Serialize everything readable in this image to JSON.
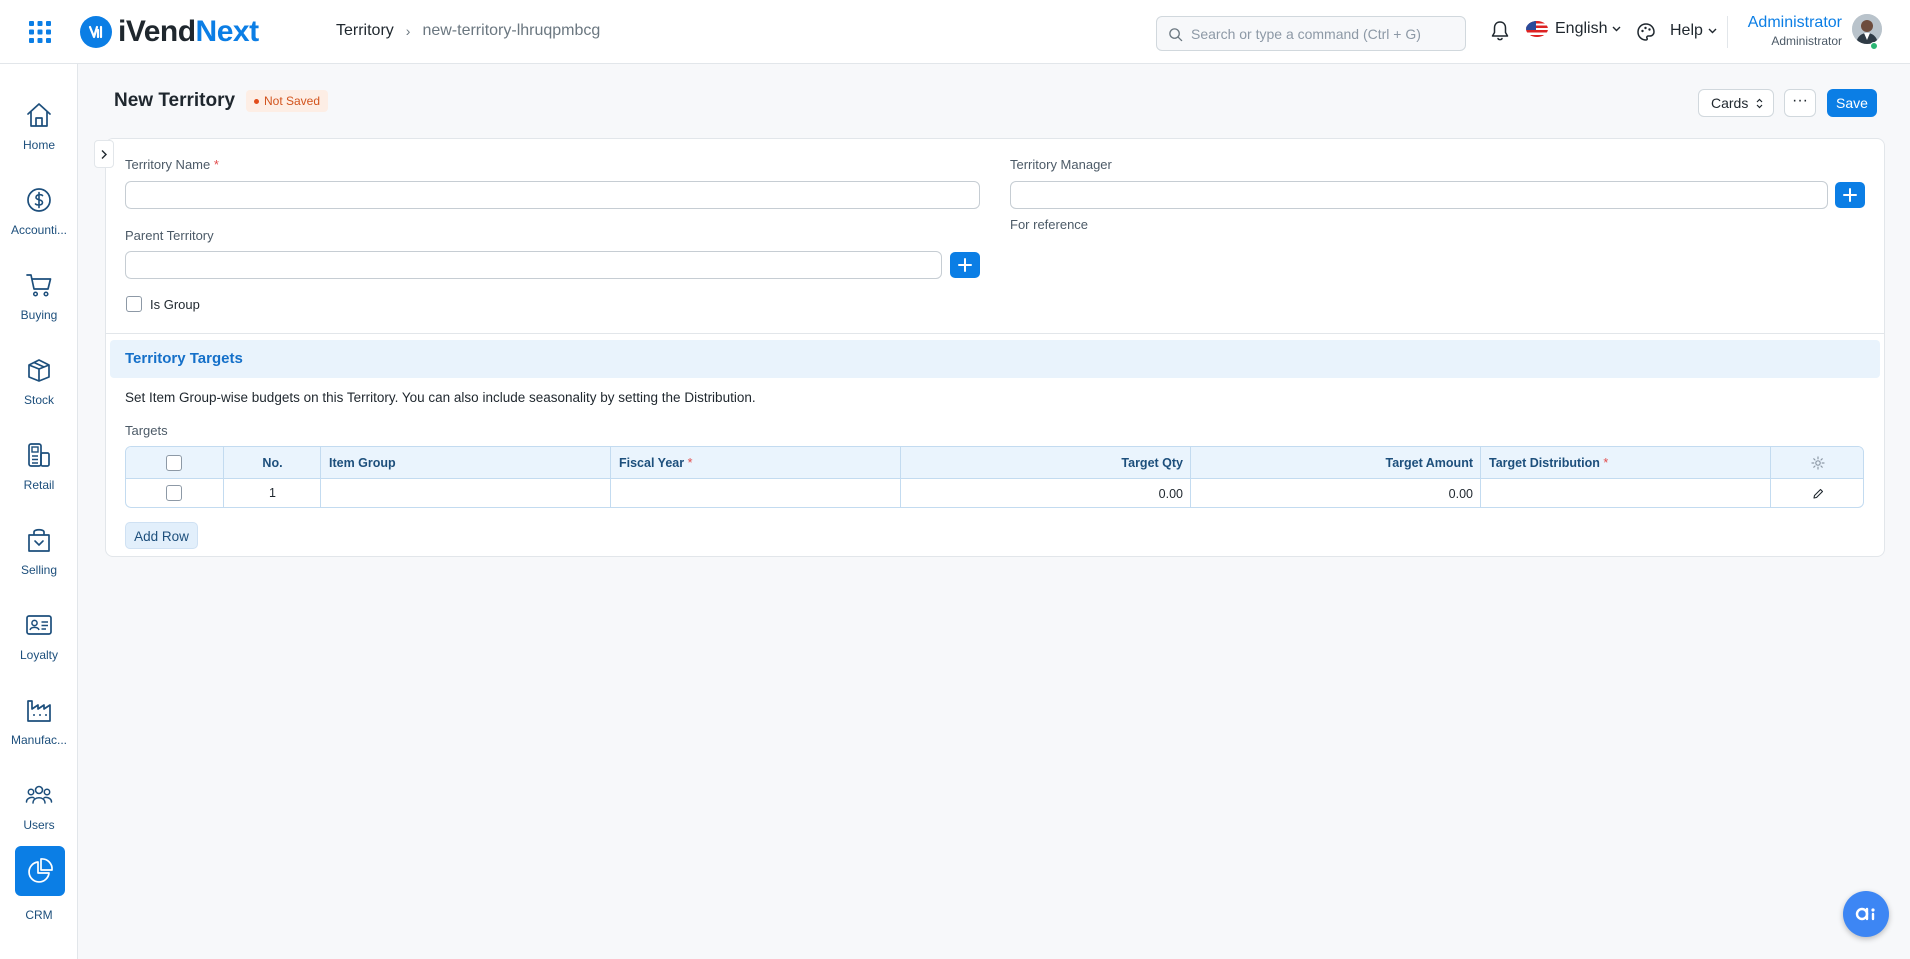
{
  "app": {
    "brand_part1": "iVend",
    "brand_part2": "Next"
  },
  "breadcrumb": {
    "root": "Territory",
    "separator": "›",
    "current": "new-territory-lhruqpmbcg"
  },
  "search": {
    "placeholder": "Search or type a command (Ctrl + G)"
  },
  "header": {
    "language": "English",
    "help": "Help",
    "user_name": "Administrator",
    "user_role": "Administrator"
  },
  "sidebar": {
    "items": [
      {
        "label": "Home",
        "icon": "home-icon"
      },
      {
        "label": "Accounti...",
        "icon": "dollar-circle-icon"
      },
      {
        "label": "Buying",
        "icon": "cart-icon"
      },
      {
        "label": "Stock",
        "icon": "box-icon"
      },
      {
        "label": "Retail",
        "icon": "pos-terminal-icon"
      },
      {
        "label": "Selling",
        "icon": "shopping-bag-icon"
      },
      {
        "label": "Loyalty",
        "icon": "id-card-icon"
      },
      {
        "label": "Manufac...",
        "icon": "factory-icon"
      },
      {
        "label": "Users",
        "icon": "users-icon"
      },
      {
        "label": "CRM",
        "icon": "pie-chart-icon",
        "active": true
      }
    ]
  },
  "page": {
    "title": "New Territory",
    "status": "Not Saved",
    "view_select": "Cards",
    "more": "···",
    "save": "Save"
  },
  "form": {
    "territory_name_label": "Territory Name",
    "territory_name_value": "",
    "parent_territory_label": "Parent Territory",
    "parent_territory_value": "",
    "is_group_label": "Is Group",
    "territory_manager_label": "Territory Manager",
    "territory_manager_value": "",
    "territory_manager_help": "For reference",
    "required_mark": "*"
  },
  "targets_section": {
    "title": "Territory Targets",
    "description": "Set Item Group-wise budgets on this Territory. You can also include seasonality by setting the Distribution.",
    "table_label": "Targets",
    "columns": {
      "no": "No.",
      "item_group": "Item Group",
      "fiscal_year": "Fiscal Year",
      "target_qty": "Target Qty",
      "target_amount": "Target Amount",
      "target_distribution": "Target Distribution"
    },
    "rows": [
      {
        "no": "1",
        "item_group": "",
        "fiscal_year": "",
        "target_qty": "0.00",
        "target_amount": "0.00",
        "target_distribution": ""
      }
    ],
    "add_row": "Add Row"
  },
  "colors": {
    "primary": "#0b7ee5",
    "status_badge_bg": "#fdeee5",
    "status_badge_text": "#d2531c",
    "section_header_bg": "#e9f3fc"
  }
}
